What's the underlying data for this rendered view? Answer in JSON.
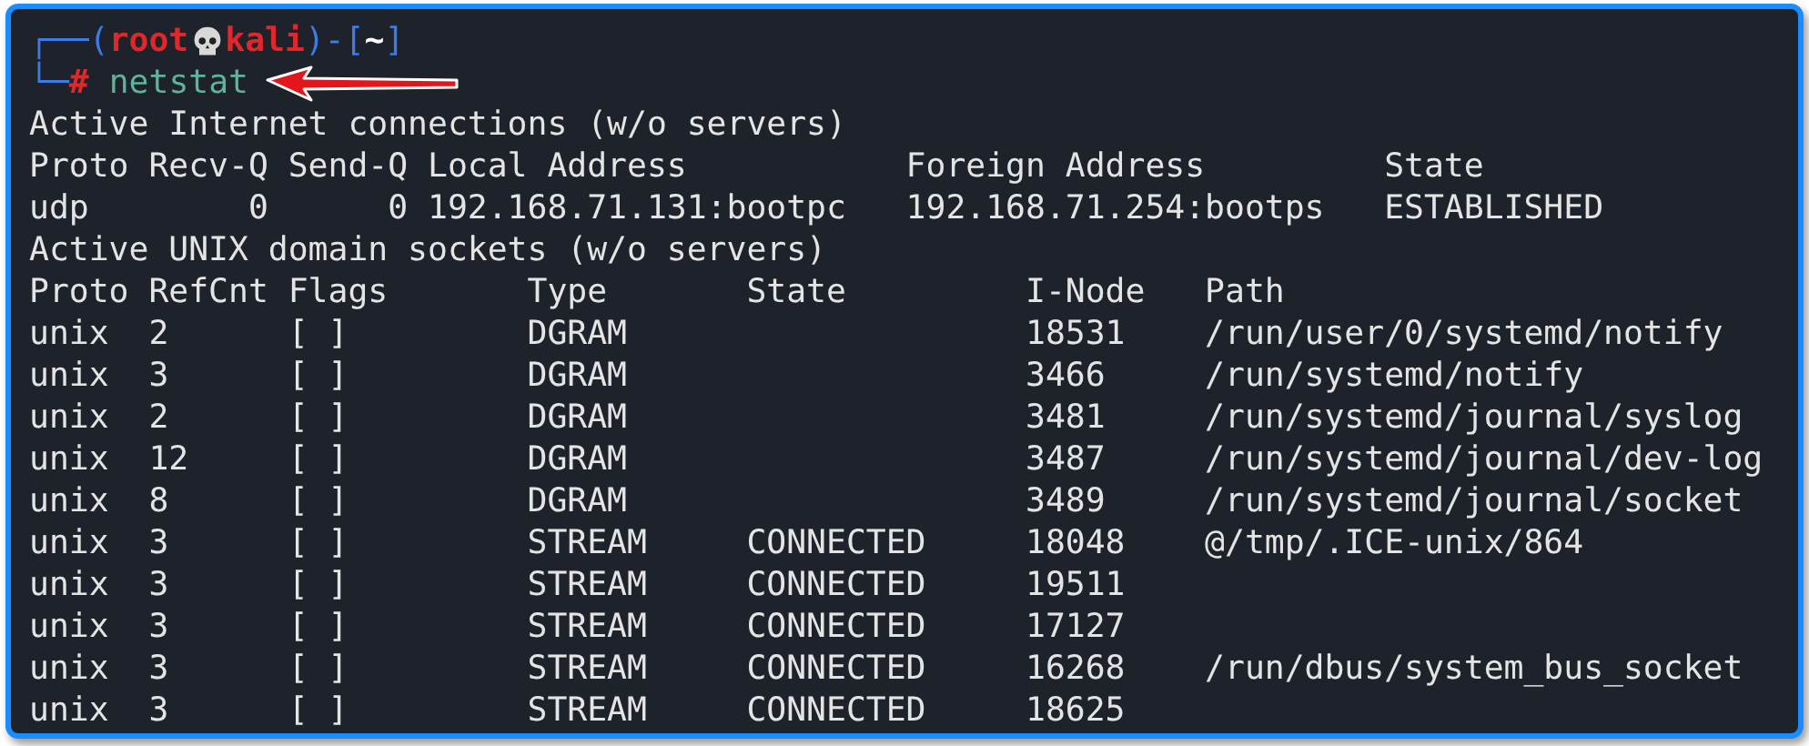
{
  "prompt": {
    "open": "┌──(",
    "user": "root",
    "host": "kali",
    "sep": ")-[",
    "dir": "~",
    "close": "]",
    "corner": "└─",
    "symbol": "#",
    "command": "netstat"
  },
  "output": [
    "Active Internet connections (w/o servers)",
    "Proto Recv-Q Send-Q Local Address           Foreign Address         State",
    "udp        0      0 192.168.71.131:bootpc   192.168.71.254:bootps   ESTABLISHED",
    "Active UNIX domain sockets (w/o servers)",
    "Proto RefCnt Flags       Type       State         I-Node   Path",
    "unix  2      [ ]         DGRAM                    18531    /run/user/0/systemd/notify",
    "unix  3      [ ]         DGRAM                    3466     /run/systemd/notify",
    "unix  2      [ ]         DGRAM                    3481     /run/systemd/journal/syslog",
    "unix  12     [ ]         DGRAM                    3487     /run/systemd/journal/dev-log",
    "unix  8      [ ]         DGRAM                    3489     /run/systemd/journal/socket",
    "unix  3      [ ]         STREAM     CONNECTED     18048    @/tmp/.ICE-unix/864",
    "unix  3      [ ]         STREAM     CONNECTED     19511",
    "unix  3      [ ]         STREAM     CONNECTED     17127",
    "unix  3      [ ]         STREAM     CONNECTED     16268    /run/dbus/system_bus_socket",
    "unix  3      [ ]         STREAM     CONNECTED     18625"
  ]
}
